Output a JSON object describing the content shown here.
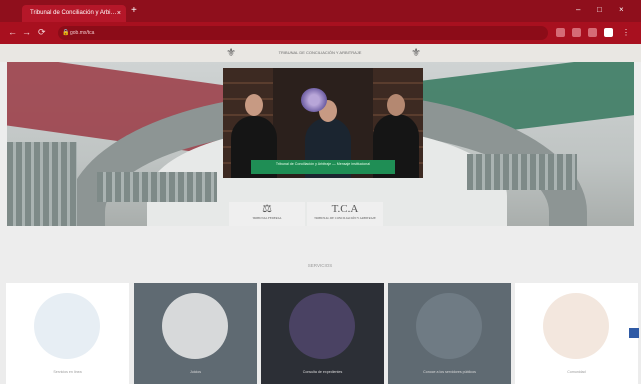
{
  "browser": {
    "tab_title": "Tribunal de Conciliación y Arbi…",
    "tab_close": "×",
    "new_tab": "+",
    "address": "gob.mx/tca",
    "minimize": "–",
    "maximize": "□",
    "close": "×",
    "back": "←",
    "forward": "→",
    "reload": "⟳",
    "lock": "🔒"
  },
  "header": {
    "text": "TRIBUNAL DE CONCILIACIÓN Y ARBITRAJE"
  },
  "hero": {
    "caption": "Tribunal de Conciliación y Arbitraje — Mensaje institucional",
    "logo_left_big": "⚖",
    "logo_left_small": "TRIBUNAL FEDERAL",
    "logo_right_big": "T.C.A",
    "logo_right_small": "TRIBUNAL DE CONCILIACIÓN Y ARBITRAJE"
  },
  "section": {
    "title": "SERVICIOS"
  },
  "cards": [
    {
      "label": "Servicios en línea",
      "bg": "#ffffff",
      "label_color": "#9a9a9a"
    },
    {
      "label": "Juicios",
      "bg": "#5f6a72",
      "label_color": "#dcdcdc"
    },
    {
      "label": "Consulta de expedientes",
      "bg": "#2c2f36",
      "label_color": "#dcdcdc"
    },
    {
      "label": "Conoce a los servidores públicos",
      "bg": "#5f6a72",
      "label_color": "#dcdcdc"
    },
    {
      "label": "Comunidad",
      "bg": "#ffffff",
      "label_color": "#9a9a9a"
    }
  ],
  "colors": {
    "chrome_dark": "#8f0f1c",
    "chrome": "#a8101f",
    "accent_green": "#1f8e55"
  }
}
